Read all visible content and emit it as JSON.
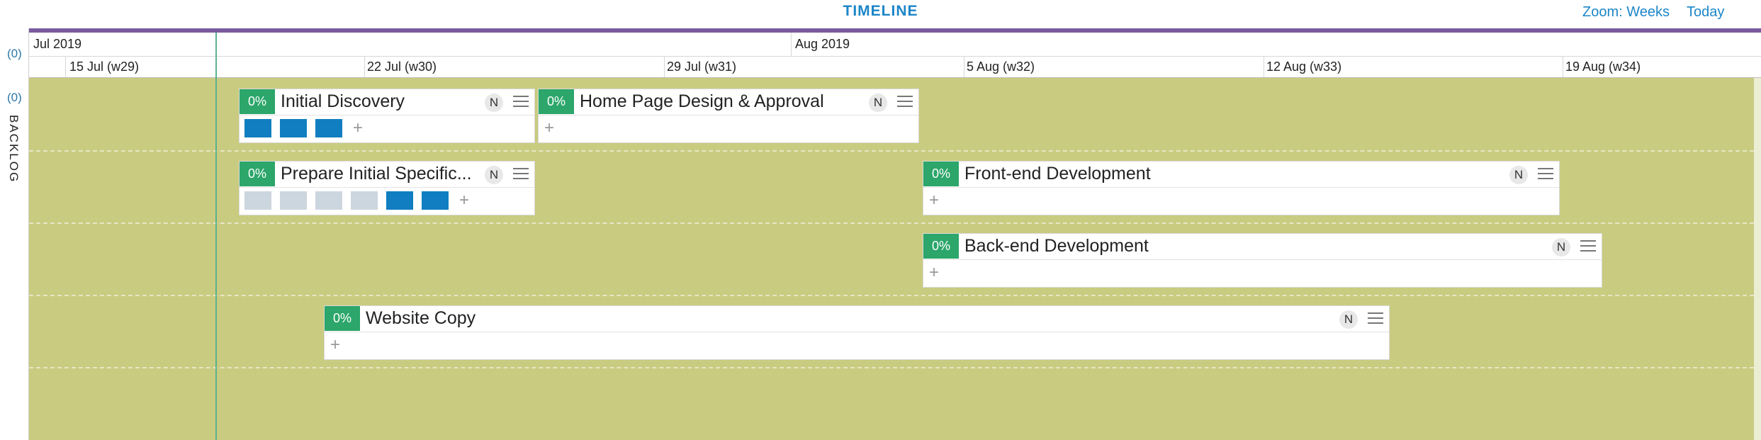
{
  "header": {
    "title": "TIMELINE",
    "zoom_label": "Zoom: Weeks",
    "today_label": "Today"
  },
  "scale": {
    "months": [
      "Jul 2019",
      "Aug 2019"
    ],
    "weeks": [
      "15 Jul (w29)",
      "22 Jul (w30)",
      "29 Jul (w31)",
      "5 Aug (w32)",
      "12 Aug (w33)",
      "19 Aug (w34)"
    ]
  },
  "left": {
    "header_count": "(0)",
    "lane_count": "(0)",
    "lane_name": "BACKLOG"
  },
  "colors": {
    "accent": "#1c86c8",
    "lane_bg": "#c9cb80",
    "progress_green": "#2ca66a",
    "subtask_done": "#107ec0",
    "subtask_todo": "#ccd6df",
    "header_bar": "#7a5b9e"
  },
  "cards": [
    {
      "title": "Initial Discovery",
      "progress": "0%",
      "badge": "N",
      "subtasks": [
        "done",
        "done",
        "done"
      ]
    },
    {
      "title": "Home Page Design & Approval",
      "progress": "0%",
      "badge": "N",
      "subtasks": []
    },
    {
      "title": "Prepare Initial Specific...",
      "progress": "0%",
      "badge": "N",
      "subtasks": [
        "todo",
        "todo",
        "todo",
        "todo",
        "done",
        "done"
      ]
    },
    {
      "title": "Front-end Development",
      "progress": "0%",
      "badge": "N",
      "subtasks": []
    },
    {
      "title": "Back-end Development",
      "progress": "0%",
      "badge": "N",
      "subtasks": []
    },
    {
      "title": "Website Copy",
      "progress": "0%",
      "badge": "N",
      "subtasks": []
    }
  ],
  "icons": {
    "menu": "menu-icon",
    "add": "plus-icon"
  },
  "add_symbol": "+"
}
